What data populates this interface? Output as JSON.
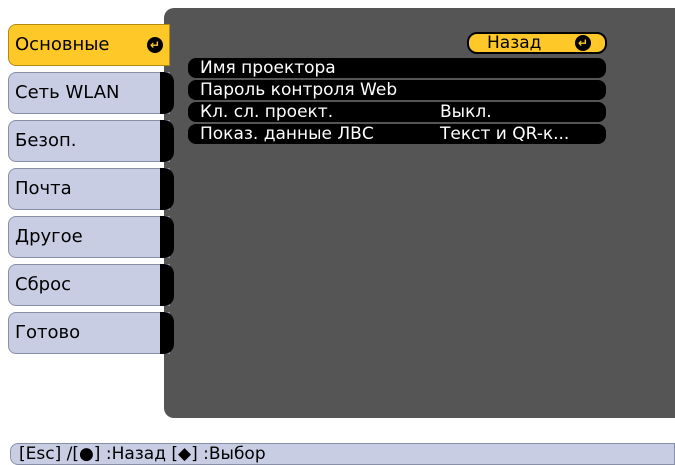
{
  "sidebar": {
    "items": [
      {
        "label": "Основные",
        "active": true
      },
      {
        "label": "Сеть WLAN",
        "active": false
      },
      {
        "label": "Безоп.",
        "active": false
      },
      {
        "label": "Почта",
        "active": false
      },
      {
        "label": "Другое",
        "active": false
      },
      {
        "label": "Сброс",
        "active": false
      },
      {
        "label": "Готово",
        "active": false
      }
    ]
  },
  "main": {
    "back_label": "Назад",
    "rows": [
      {
        "label": "Имя проектора",
        "value": ""
      },
      {
        "label": "Пароль контроля Web",
        "value": ""
      },
      {
        "label": "Кл. сл. проект.",
        "value": "Выкл."
      },
      {
        "label": "Показ. данные ЛВС",
        "value": "Текст и QR-к..."
      }
    ]
  },
  "helpbar": {
    "text": "[Esc] /[●] :Назад  [◆] :Выбор"
  },
  "colors": {
    "accent": "#ffc829",
    "tab_bg": "#c9cde3",
    "panel_bg": "#555555"
  },
  "icons": {
    "enter": "enter-icon",
    "updown": "up-down-arrow-icon"
  }
}
